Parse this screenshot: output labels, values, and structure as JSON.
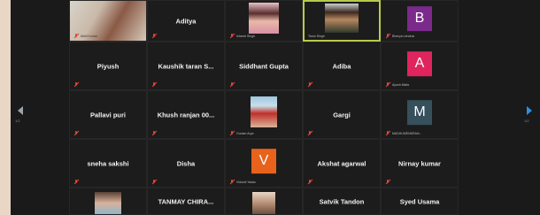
{
  "colors": {
    "window_bg": "#1a1a1a",
    "tile_bg": "#1c1c1c",
    "active_speaker_border": "#b9c94a",
    "muted_mic": "#e0463a",
    "avatar_B": "#7b2a8c",
    "avatar_A": "#e0245e",
    "avatar_M": "#36505c",
    "avatar_V": "#e8621c"
  },
  "icons": {
    "muted": "mic-muted-icon",
    "prev": "chevron-left-icon",
    "next": "chevron-right-icon"
  },
  "nav": {
    "prev_page": "1/2",
    "next_page": "1/2"
  },
  "participants": {
    "row1": [
      {
        "name": "",
        "caption": "Akhil Kumar",
        "type": "video"
      },
      {
        "name": "Aditya",
        "caption": "",
        "type": "name"
      },
      {
        "name": "",
        "caption": "Ishanvi Singh",
        "type": "photo"
      },
      {
        "name": "",
        "caption": "Tarun Singh",
        "type": "photo"
      },
      {
        "name": "",
        "caption": "Bhavya Lendrax",
        "type": "avatar",
        "initial": "B"
      }
    ],
    "row2": [
      {
        "name": "Piyush",
        "caption": "",
        "type": "name"
      },
      {
        "name": "Kaushik taran S...",
        "caption": "",
        "type": "name"
      },
      {
        "name": "Siddhant Gupta",
        "caption": "",
        "type": "name"
      },
      {
        "name": "Adiba",
        "caption": "",
        "type": "name"
      },
      {
        "name": "",
        "caption": "Ayush Malla",
        "type": "avatar",
        "initial": "A"
      }
    ],
    "row3": [
      {
        "name": "Pallavi puri",
        "caption": "",
        "type": "name"
      },
      {
        "name": "Khush ranjan 00...",
        "caption": "",
        "type": "name"
      },
      {
        "name": "",
        "caption": "Gunam Arya",
        "type": "photo"
      },
      {
        "name": "Gargi",
        "caption": "",
        "type": "name"
      },
      {
        "name": "",
        "caption": "MADHUMENDRAN...",
        "type": "avatar",
        "initial": "M"
      }
    ],
    "row4": [
      {
        "name": "sneha sakshi",
        "caption": "",
        "type": "name"
      },
      {
        "name": "Disha",
        "caption": "",
        "type": "name"
      },
      {
        "name": "",
        "caption": "Vidushi Yadav",
        "type": "avatar",
        "initial": "V"
      },
      {
        "name": "Akshat agarwal",
        "caption": "",
        "type": "name"
      },
      {
        "name": "Nirnay kumar",
        "caption": "",
        "type": "name"
      }
    ],
    "row5": [
      {
        "name": "",
        "caption": "",
        "type": "photo"
      },
      {
        "name": "TANMAY CHIRA...",
        "caption": "",
        "type": "name"
      },
      {
        "name": "",
        "caption": "",
        "type": "photo"
      },
      {
        "name": "Satvik Tandon",
        "caption": "",
        "type": "name"
      },
      {
        "name": "Syed Usama",
        "caption": "",
        "type": "name"
      }
    ]
  }
}
